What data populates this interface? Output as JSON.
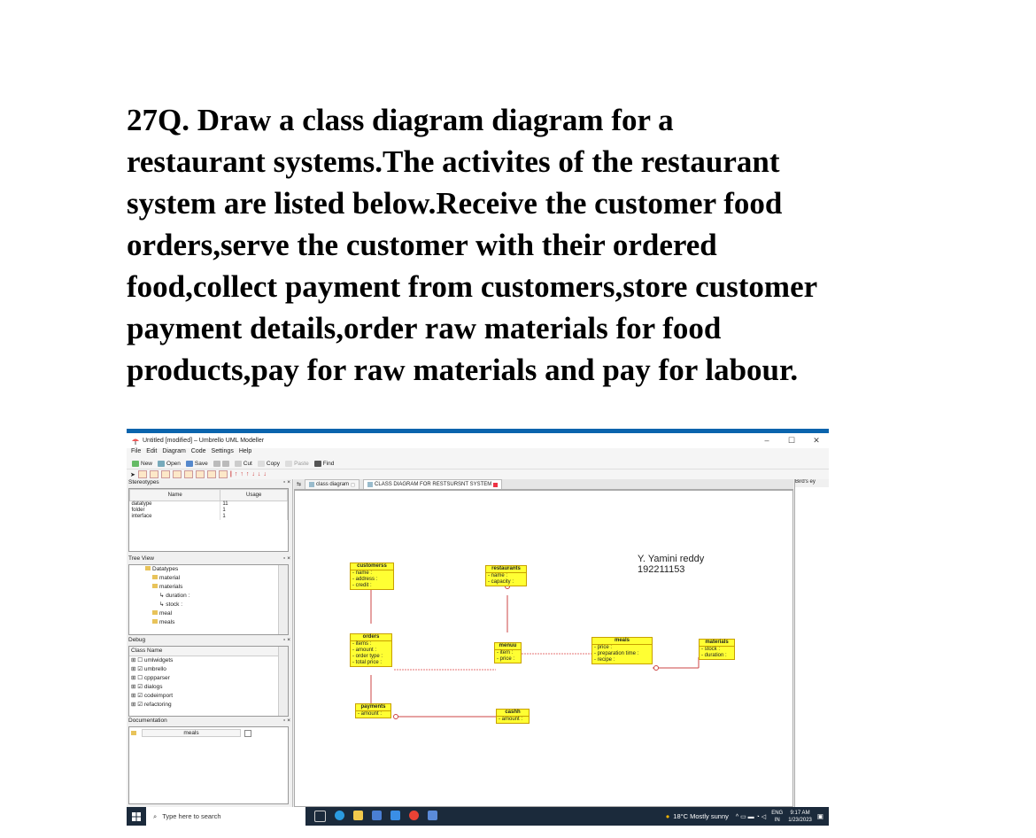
{
  "question": {
    "lines": [
      "27Q. Draw a class diagram  diagram for a",
      "restaurant systems.The activites of the restaurant",
      "system are listed below.Receive the customer food",
      "orders,serve the customer with their ordered",
      "food,collect payment from customers,store customer",
      "payment details,order raw materials for food",
      "products,pay for raw materials and pay for labour."
    ]
  },
  "window": {
    "title": "Untitled [modified] – Umbrello UML Modeller",
    "controls": {
      "minimize": "–",
      "maximize": "☐",
      "close": "✕"
    }
  },
  "menu": [
    "File",
    "Edit",
    "Diagram",
    "Code",
    "Settings",
    "Help"
  ],
  "toolbar": {
    "new": "New",
    "open": "Open",
    "save": "Save",
    "cut": "Cut",
    "copy": "Copy",
    "paste": "Paste",
    "find": "Find"
  },
  "stereotypes": {
    "header": "Stereotypes",
    "columns": [
      "Name",
      "Usage"
    ],
    "rows": [
      {
        "name": "datatype",
        "usage": "11"
      },
      {
        "name": "folder",
        "usage": "1"
      },
      {
        "name": "interface",
        "usage": "1"
      }
    ]
  },
  "tree_view": {
    "header": "Tree View",
    "items": [
      "Datatypes",
      "material",
      "materials",
      "duration :",
      "stock :",
      "meal",
      "meals"
    ]
  },
  "debug": {
    "header": "Debug",
    "column": "Class Name",
    "items": [
      "umlwidgets",
      "umbrello",
      "cppparser",
      "dialogs",
      "codeimport",
      "refactoring"
    ]
  },
  "documentation": {
    "header": "Documentation",
    "value": "meals"
  },
  "tabs": [
    {
      "label": "class diagram"
    },
    {
      "label": "CLASS DIAGRAM FOR RESTSURSNT SYSTEM"
    }
  ],
  "birds_eye": {
    "label": "Bird's ey"
  },
  "diagram": {
    "author_name": "Y. Yamini reddy",
    "author_id": "192211153",
    "classes": {
      "customerss": {
        "name": "customerss",
        "attrs": [
          "- name :",
          "- address :",
          "- credit :"
        ]
      },
      "restaurants": {
        "name": "restaurants",
        "attrs": [
          "- name :",
          "- capacity :"
        ]
      },
      "orders": {
        "name": "orders",
        "attrs": [
          "- items :",
          "- amount :",
          "- order type :",
          "- total price :"
        ]
      },
      "menuu": {
        "name": "menuu",
        "attrs": [
          "- item :",
          "- price :"
        ]
      },
      "meals": {
        "name": "meals",
        "attrs": [
          "- price :",
          "- preparation time :",
          "- recipe :"
        ]
      },
      "materials": {
        "name": "materials",
        "attrs": [
          "- stock :",
          "- duration :"
        ]
      },
      "payments": {
        "name": "payments",
        "attrs": [
          "- amount :"
        ]
      },
      "cashh": {
        "name": "cashh",
        "attrs": [
          "- amount :"
        ]
      }
    }
  },
  "taskbar": {
    "search_placeholder": "Type here to search",
    "weather": "18°C  Mostly sunny",
    "lang_top": "ENG",
    "lang_bottom": "IN",
    "time": "9:17 AM",
    "date": "1/23/2023"
  },
  "colors": {
    "class_fill": "#ffff33",
    "association": "#c44",
    "dependency": "#e57373",
    "window_accent": "#0a64ad"
  }
}
